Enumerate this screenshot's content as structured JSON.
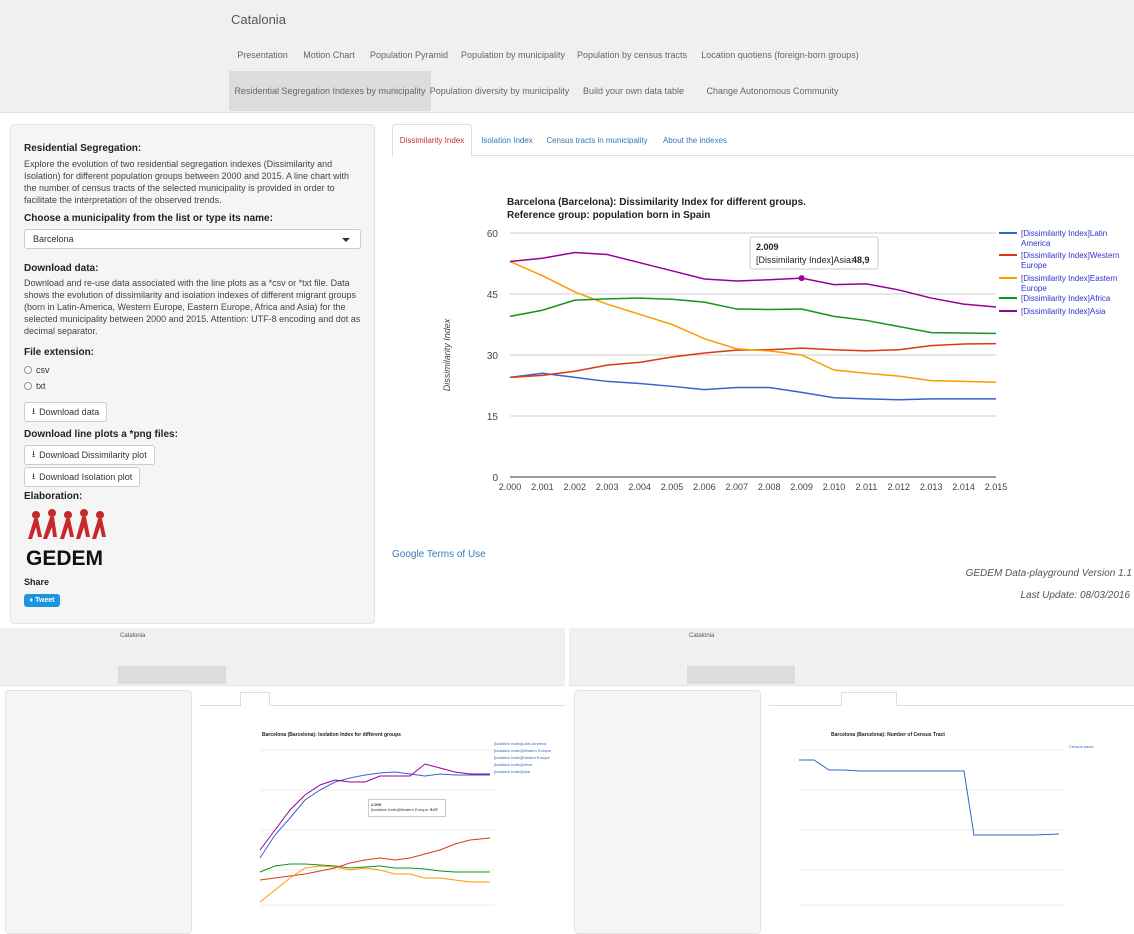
{
  "app": {
    "title": "Catalonia"
  },
  "nav": {
    "items": [
      {
        "label": "Presentation"
      },
      {
        "label": "Motion Chart"
      },
      {
        "label": "Population Pyramid"
      },
      {
        "label": "Population by municipality"
      },
      {
        "label": "Population by census tracts"
      },
      {
        "label": "Location quotiens (foreign-born groups)"
      },
      {
        "label": "Residential Segregation Indexes by municipality",
        "active": true
      },
      {
        "label": "Population diversity by municipality"
      },
      {
        "label": "Build your own data table"
      },
      {
        "label": "Change Autonomous Community"
      }
    ]
  },
  "sidebar": {
    "heading": "Residential Segregation:",
    "intro": "Explore the evolution of two residential segregation indexes (Dissimilarity and Isolation) for different population groups between 2000 and 2015. A line chart with the number of census tracts of the selected municipality is provided in order to facilitate the interpretation of the observed trends.",
    "municipality_label": "Choose a municipality from the list or type its name:",
    "municipality_value": "Barcelona",
    "download_heading": "Download data:",
    "download_text": "Download and re-use data associated with the line plots as a *csv or *txt file. Data shows the evolution of dissimilarity and isolation indexes of different migrant groups (born in Latin-America, Western Europe, Eastern Europe, Africa and Asia) for the selected municipality between 2000 and 2015. Attention: UTF-8 encoding and dot as decimal separator.",
    "file_ext_label": "File extension:",
    "radio_csv": "csv",
    "radio_txt": "txt",
    "selected_ext": "csv",
    "download_data_btn": "Download data",
    "plots_heading": "Download line plots a *png files:",
    "dissim_btn": "Download Dissimilarity plot",
    "isolation_btn": "Download Isolation plot",
    "elaboration": "Elaboration:",
    "logo_text": "GEDEM",
    "share": "Share",
    "tweet": "Tweet"
  },
  "tabs": [
    {
      "label": "Dissimilarity Index",
      "active": true
    },
    {
      "label": "Isolation Index"
    },
    {
      "label": "Census tracts in municipality"
    },
    {
      "label": "About the indexes"
    }
  ],
  "chart_data": {
    "type": "line",
    "title": "Barcelona (Barcelona): Dissimilarity Index for different groups.",
    "subtitle": "Reference group: population born in Spain",
    "ylabel": "Dissimilarity Index",
    "ylim": [
      0,
      60
    ],
    "yticks": [
      "0",
      "15",
      "30",
      "45",
      "60"
    ],
    "x": [
      "2.000",
      "2.001",
      "2.002",
      "2.003",
      "2.004",
      "2.005",
      "2.006",
      "2.007",
      "2.008",
      "2.009",
      "2.010",
      "2.011",
      "2.012",
      "2.013",
      "2.014",
      "2.015"
    ],
    "series": [
      {
        "name": "[Dissimilarity Index]Latin America",
        "color": "#3366cc",
        "values": [
          24.5,
          25.5,
          24.5,
          23.5,
          23,
          22.3,
          21.5,
          22,
          22,
          20.8,
          19.5,
          19.2,
          19,
          19.2,
          19.2,
          19.2
        ]
      },
      {
        "name": "[Dissimilarity Index]Western Europe",
        "color": "#dc3912",
        "values": [
          24.5,
          25,
          26,
          27.5,
          28.2,
          29.5,
          30.5,
          31.2,
          31.3,
          31.7,
          31.3,
          31,
          31.3,
          32.3,
          32.7,
          32.8
        ]
      },
      {
        "name": "[Dissimilarity Index]Eastern Europe",
        "color": "#ff9900",
        "values": [
          53,
          49.5,
          45.5,
          42.5,
          40,
          37.5,
          34,
          31.5,
          31,
          30,
          26.3,
          25.5,
          24.8,
          23.7,
          23.5,
          23.3
        ]
      },
      {
        "name": "[Dissimilarity Index]Africa",
        "color": "#109618",
        "values": [
          39.5,
          41,
          43.5,
          43.8,
          44,
          43.7,
          43,
          41.3,
          41.2,
          41.3,
          39.5,
          38.5,
          37,
          35.5,
          35.4,
          35.3
        ]
      },
      {
        "name": "[Dissimilarity Index]Asia",
        "color": "#990099",
        "values": [
          53,
          53.8,
          55.2,
          54.7,
          52.7,
          50.7,
          48.7,
          48.2,
          48.5,
          48.9,
          47.3,
          47.5,
          46,
          44,
          42.5,
          41.8
        ]
      }
    ],
    "legend": "right",
    "tooltip": {
      "year": "2.009",
      "label": "[Dissimilarity Index]Asia:",
      "value": "48,9"
    }
  },
  "google_terms": "Google Terms of Use",
  "footer": {
    "version": "GEDEM Data-playground Version 1.1",
    "update": "Last Update: 08/03/2016"
  },
  "thumb_isolation": {
    "title": "Barcelona (Barcelona): Isolation Index for different groups",
    "tooltip_year": "2.009",
    "tooltip_label": "[Isolation Index]Western Europe:",
    "tooltip_value": "5.07",
    "legend": [
      "[Isolation Index]Latin America",
      "[Isolation Index]Western Europe",
      "[Isolation Index]Eastern Europe",
      "[Isolation Index]Africa",
      "[Isolation Index]Asia"
    ]
  },
  "thumb_census": {
    "title": "Barcelona (Barcelona): Number of Census Tract",
    "legend": "Census tracts"
  }
}
